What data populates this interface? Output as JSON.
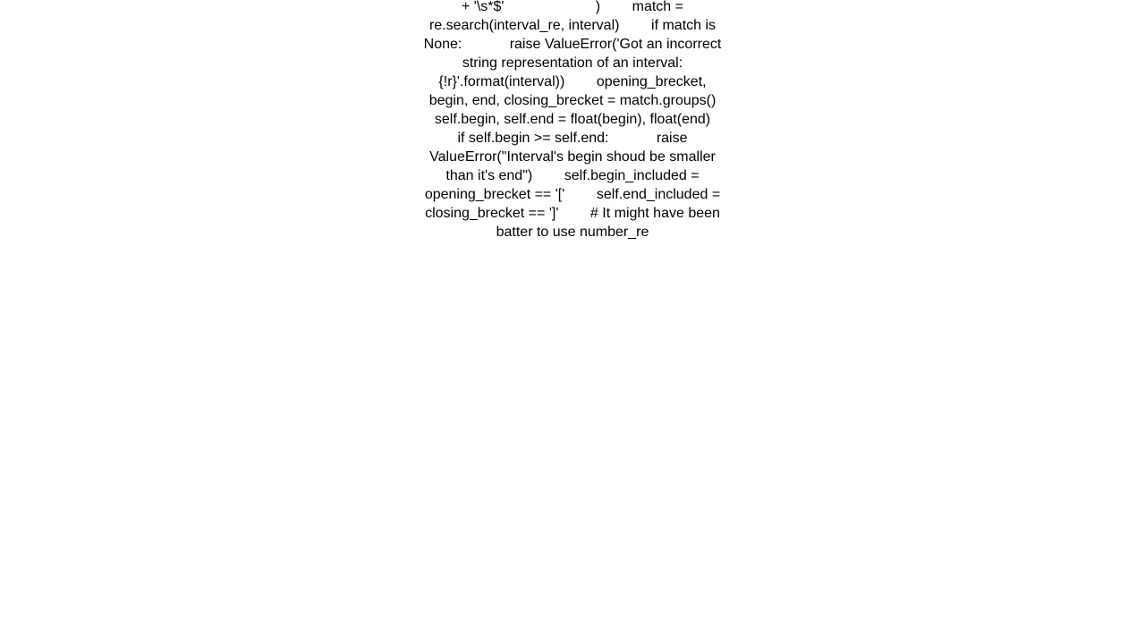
{
  "document": {
    "background_color": "#ffffff",
    "text_color": "#000000",
    "alignment": "center",
    "code": "    def __init__(self, interval):        if isinstance(interval, Interval):            self.begin, self.end = interval.begin, interval.end            self.begin_included = interval.begin_included            self.end_included = interval.end_included            return        number_re = '-?[0-9]+(?:.[0-9]+)?'        interval_re = ('^\\s*'                       +'(\\[|\\()'  # opeing brecket                       + '\\s*'                       + '(' + number_re + ')'  # beginning of the interval                       +  '\\s*,\\s*'                       + '(' + number_re + ')'  # end of the interval                       + '\\s*'                       +  '(\\]|\\))'  # closing brecket                       + '\\s*$'                       )        match = re.search(interval_re, interval)        if match is None:            raise ValueError('Got an incorrect string representation of an interval: {!r}'.format(interval))        opening_brecket, begin, end, closing_brecket = match.groups()        self.begin, self.end = float(begin), float(end)        if self.begin >= self.end:            raise ValueError(\"Interval's begin shoud be smaller than it's end\")        self.begin_included = opening_brecket == '['        self.end_included = closing_brecket == ']'        # It might have been batter to use number_re"
  }
}
